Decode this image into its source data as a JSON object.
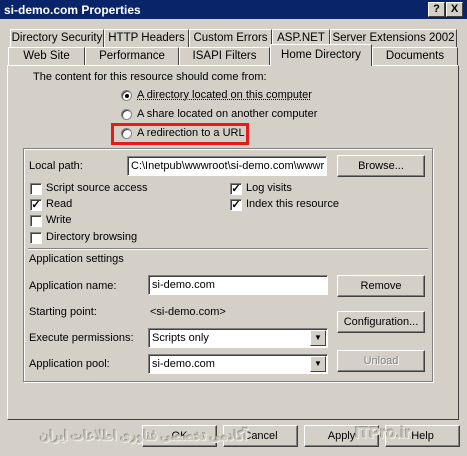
{
  "window": {
    "title": "si-demo.com Properties",
    "help_button": "?",
    "close_button": "X"
  },
  "tabs_row1": [
    "Directory Security",
    "HTTP Headers",
    "Custom Errors",
    "ASP.NET",
    "Server Extensions 2002"
  ],
  "tabs_row2": [
    "Web Site",
    "Performance",
    "ISAPI Filters",
    "Home Directory",
    "Documents"
  ],
  "active_tab": "Home Directory",
  "content_source": {
    "prompt": "The content for this resource should come from:",
    "options": [
      {
        "label": "A directory located on this computer",
        "selected": true
      },
      {
        "label": "A share located on another computer",
        "selected": false
      },
      {
        "label": "A redirection to a URL",
        "selected": false
      }
    ],
    "highlight_color": "#e31b1b"
  },
  "local_path": {
    "label": "Local path:",
    "value": "C:\\Inetpub\\wwwroot\\si-demo.com\\wwwr",
    "browse_label": "Browse..."
  },
  "checkboxes_left": [
    {
      "label": "Script source access",
      "checked": false
    },
    {
      "label": "Read",
      "checked": true
    },
    {
      "label": "Write",
      "checked": false
    },
    {
      "label": "Directory browsing",
      "checked": false
    }
  ],
  "checkboxes_right": [
    {
      "label": "Log visits",
      "checked": true
    },
    {
      "label": "Index this resource",
      "checked": true
    }
  ],
  "app_settings": {
    "heading": "Application settings",
    "name_label": "Application name:",
    "name_value": "si-demo.com",
    "remove_label": "Remove",
    "start_label": "Starting point:",
    "start_value": "<si-demo.com>",
    "config_label": "Configuration...",
    "exec_label": "Execute permissions:",
    "exec_value": "Scripts only",
    "pool_label": "Application pool:",
    "pool_value": "si-demo.com",
    "unload_label": "Unload"
  },
  "footer": {
    "ok_label": "OK",
    "cancel_label": "Cancel",
    "apply_label": "Apply",
    "help_label": "Help"
  },
  "watermark": {
    "arabic": "آکادمی تخصصی فناوری اطلاعات ایران",
    "latin": "ITPro.ir"
  }
}
